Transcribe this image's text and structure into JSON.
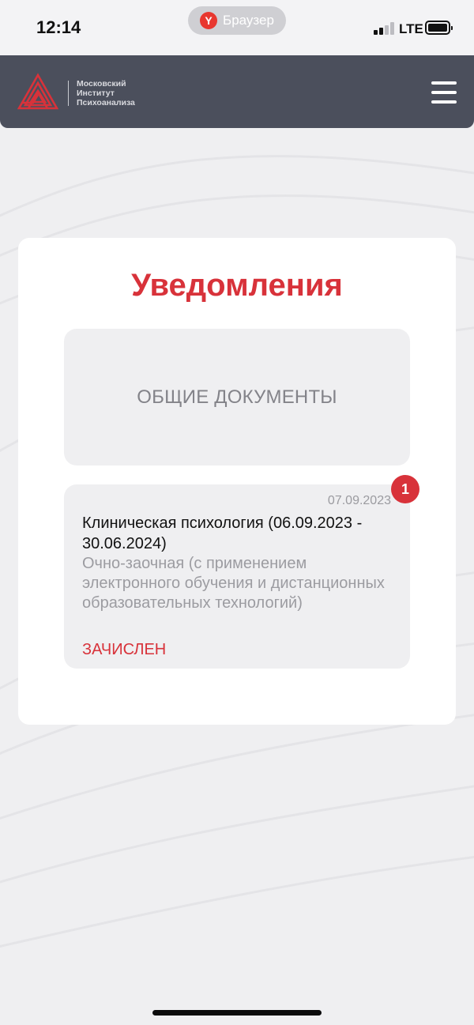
{
  "status_bar": {
    "time": "12:14",
    "browser_label": "Браузер",
    "browser_icon": "yandex-icon",
    "network": "LTE",
    "signal_bars": 2,
    "signal_bars_total": 4,
    "battery_icon": "battery-full-icon"
  },
  "header": {
    "background": "#4b4f5c",
    "logo_icon": "triangle-maze-logo-icon",
    "logo_line_1": "Московский",
    "logo_line_2": "Институт",
    "logo_line_3": "Психоанализа",
    "menu_icon": "hamburger-menu-icon"
  },
  "page": {
    "title": "Уведомления",
    "accent_color": "#d8323a",
    "general_docs_label": "ОБЩИЕ ДОКУМЕНТЫ",
    "notifications": [
      {
        "date": "07.09.2023",
        "badge_count": "1",
        "program": "Клиническая психология (06.09.2023 - 30.06.2024)",
        "study_format": "Очно-заочная (с применением электронного обучения и дистанционных образовательных технологий)",
        "status": "ЗАЧИСЛЕН"
      }
    ]
  }
}
